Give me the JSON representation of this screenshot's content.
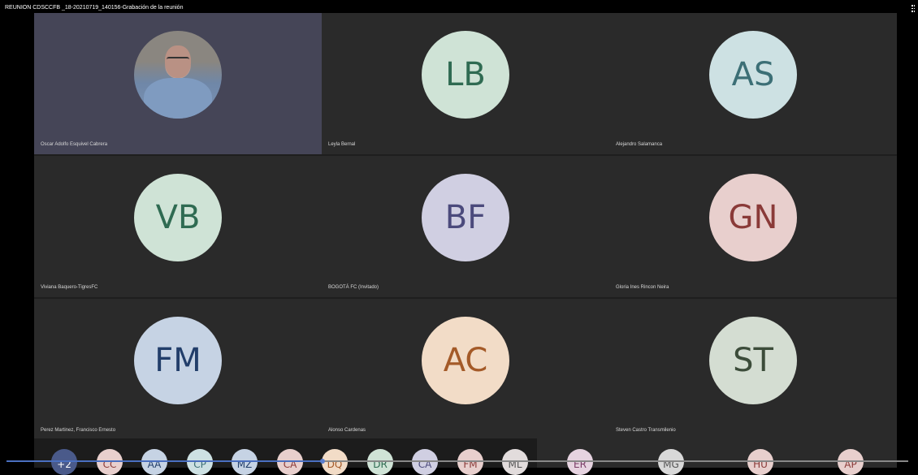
{
  "window": {
    "title": "REUNION CDSCCFB _18-20210719_140156-Grabación de la reunión"
  },
  "participants": [
    {
      "name": "Oscar Adolfo Esquivel Cabrera",
      "initials": "",
      "video": true,
      "speaking": true,
      "bg": "#bfc4cf",
      "fg": "#333333"
    },
    {
      "name": "Leyla Bernal",
      "initials": "LB",
      "video": false,
      "bg": "#cfe3d6",
      "fg": "#2f6b52"
    },
    {
      "name": "Alejandro Salamanca",
      "initials": "AS",
      "video": false,
      "bg": "#cde1e3",
      "fg": "#3c6f76"
    },
    {
      "name": "Viviana Baquero-TigresFC",
      "initials": "VB",
      "video": false,
      "bg": "#cfe3d6",
      "fg": "#2f6b52"
    },
    {
      "name": "BOGOTÁ FC (Invitado)",
      "initials": "BF",
      "video": false,
      "bg": "#d0cfe2",
      "fg": "#4b4a7c"
    },
    {
      "name": "Gloria Ines Rincon Neira",
      "initials": "GN",
      "video": false,
      "bg": "#e8cfcd",
      "fg": "#8a3a38"
    },
    {
      "name": "Perez Martinez, Francisco Ernesto",
      "initials": "FM",
      "video": false,
      "bg": "#c6d3e4",
      "fg": "#223e6a"
    },
    {
      "name": "Alonso Cardenas",
      "initials": "AC",
      "video": false,
      "bg": "#f2dcc7",
      "fg": "#a45a28"
    },
    {
      "name": "Steven Castro Transmilenio",
      "initials": "ST",
      "video": false,
      "bg": "#d4ddd2",
      "fg": "#3c4c3a"
    }
  ],
  "overflow": {
    "more_label": "+2",
    "avatars": [
      {
        "initials": "CC",
        "bg": "#e8cfcd",
        "fg": "#8a3a38"
      },
      {
        "initials": "AA",
        "bg": "#c6d3e4",
        "fg": "#223e6a"
      },
      {
        "initials": "CP",
        "bg": "#cde1e3",
        "fg": "#3c6f76"
      },
      {
        "initials": "MZ",
        "bg": "#c6d3e4",
        "fg": "#223e6a"
      },
      {
        "initials": "CA",
        "bg": "#e8cfcd",
        "fg": "#8a3a38"
      },
      {
        "initials": "DQ",
        "bg": "#f2dcc7",
        "fg": "#a45a28"
      },
      {
        "initials": "DR",
        "bg": "#cfe3d6",
        "fg": "#2f6b52"
      },
      {
        "initials": "CA",
        "bg": "#d0cfe2",
        "fg": "#4b4a7c"
      },
      {
        "initials": "FM",
        "bg": "#e8cfcd",
        "fg": "#8a3a38"
      },
      {
        "initials": "ML",
        "bg": "#e2dcdc",
        "fg": "#555555"
      },
      {
        "initials": "ER",
        "bg": "#e6d3e0",
        "fg": "#7a3c66"
      },
      {
        "initials": "MG",
        "bg": "#d8d8d8",
        "fg": "#555555"
      },
      {
        "initials": "HU",
        "bg": "#e8cfcd",
        "fg": "#8a3a38"
      },
      {
        "initials": "AP",
        "bg": "#e8cfcd",
        "fg": "#8a3a38"
      }
    ]
  },
  "playback": {
    "progress_percent": 35,
    "colors": {
      "fill": "#4a6fc0",
      "track": "#888888"
    }
  }
}
